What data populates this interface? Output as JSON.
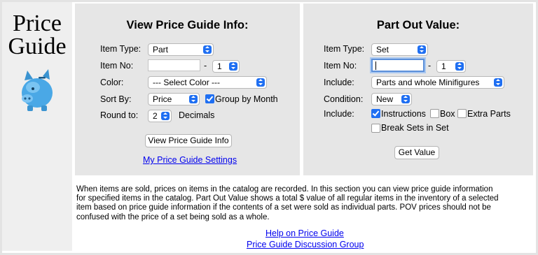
{
  "brand": {
    "title_line1": "Price",
    "title_line2": "Guide",
    "logo_icon": "piggy-bank-icon"
  },
  "guide_panel": {
    "heading": "View Price Guide Info:",
    "item_type_label": "Item Type:",
    "item_type_value": "Part",
    "item_no_label": "Item No:",
    "item_no_value": "",
    "dash": "-",
    "item_no_seq": "1",
    "color_label": "Color:",
    "color_value": "--- Select Color ---",
    "sort_label": "Sort By:",
    "sort_value": "Price",
    "group_by_month_label": "Group by Month",
    "group_by_month_checked": true,
    "round_label": "Round to:",
    "round_value": "2",
    "decimals_label": "Decimals",
    "button": "View Price Guide Info",
    "settings_link": "My Price Guide Settings"
  },
  "pov_panel": {
    "heading": "Part Out Value:",
    "item_type_label": "Item Type:",
    "item_type_value": "Set",
    "item_no_label": "Item No:",
    "item_no_value": "",
    "dash": "-",
    "item_no_seq": "1",
    "include_label": "Include:",
    "include_value": "Parts and whole Minifigures",
    "condition_label": "Condition:",
    "condition_value": "New",
    "include2_label": "Include:",
    "instructions_label": "Instructions",
    "instructions_checked": true,
    "box_label": "Box",
    "box_checked": false,
    "extra_parts_label": "Extra Parts",
    "extra_parts_checked": false,
    "break_sets_label": "Break Sets in Set",
    "break_sets_checked": false,
    "button": "Get Value"
  },
  "info": {
    "line1": "When items are sold, prices on items in the catalog are recorded. In this section you can view price guide information",
    "line2": "for specified items in the catalog. Part Out Value shows a total $ value of all regular items in the inventory of a selected",
    "line3": "item based on price guide information if the contents of a set were sold as individual parts. POV prices should not be",
    "line4": "confused with the price of a set being sold as a whole."
  },
  "links": {
    "help": "Help on Price Guide",
    "discussion": "Price Guide Discussion Group"
  },
  "colors": {
    "accent": "#1f6ff2",
    "panel_bg": "#e6e6e6",
    "link": "#0000ee",
    "pig": "#4aa8e6"
  }
}
